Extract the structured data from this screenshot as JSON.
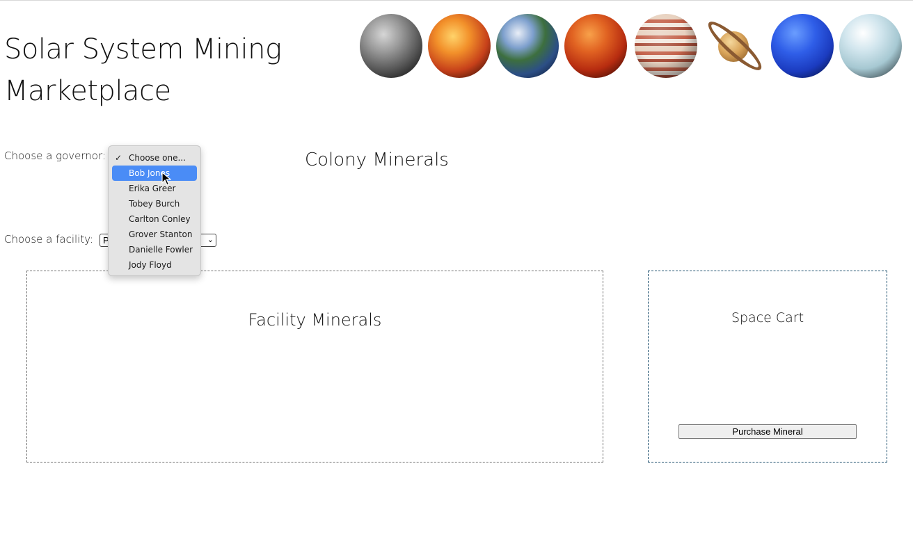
{
  "header": {
    "title_line1": "Solar System Mining",
    "title_line2": "Marketplace",
    "planets": [
      "mercury",
      "venus",
      "earth",
      "mars",
      "jupiter",
      "saturn",
      "neptune",
      "uranus"
    ]
  },
  "governor": {
    "label": "Choose a governor:",
    "checkmark": "✓",
    "options": [
      "Choose one...",
      "Bob Jones",
      "Erika Greer",
      "Tobey Burch",
      "Carlton Conley",
      "Grover Stanton",
      "Danielle Fowler",
      "Jody Floyd"
    ],
    "checked_option": "Choose one...",
    "highlighted_option": "Bob Jones"
  },
  "facility": {
    "label": "Choose a facility:",
    "selected_visible": "P",
    "chevron": "⌄"
  },
  "colony": {
    "title": "Colony Minerals"
  },
  "facility_minerals": {
    "title": "Facility Minerals"
  },
  "cart": {
    "title": "Space Cart",
    "purchase_label": "Purchase Mineral"
  },
  "colors": {
    "highlight": "#4a8cf6",
    "cart_border": "#1d4f6e",
    "facility_border": "#6f6f6f"
  }
}
